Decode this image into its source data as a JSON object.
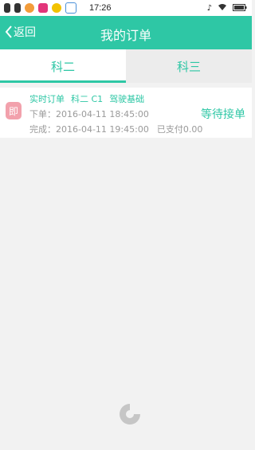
{
  "statusbar": {
    "time": "17:26"
  },
  "appbar": {
    "back_label": "返回",
    "title": "我的订单"
  },
  "tabs": [
    {
      "label": "科二"
    },
    {
      "label": "科三"
    }
  ],
  "order": {
    "badge": "即",
    "type": "实时订单",
    "subject": "科二 C1",
    "category": "驾驶基础",
    "order_time": "下单：2016-04-11 18:45:00",
    "complete_time": "完成：2016-04-11 19:45:00",
    "paid": "已支付0.00",
    "status": "等待接单"
  },
  "colors": {
    "accent": "#2ec7a5",
    "badge": "#f2a1ac"
  }
}
